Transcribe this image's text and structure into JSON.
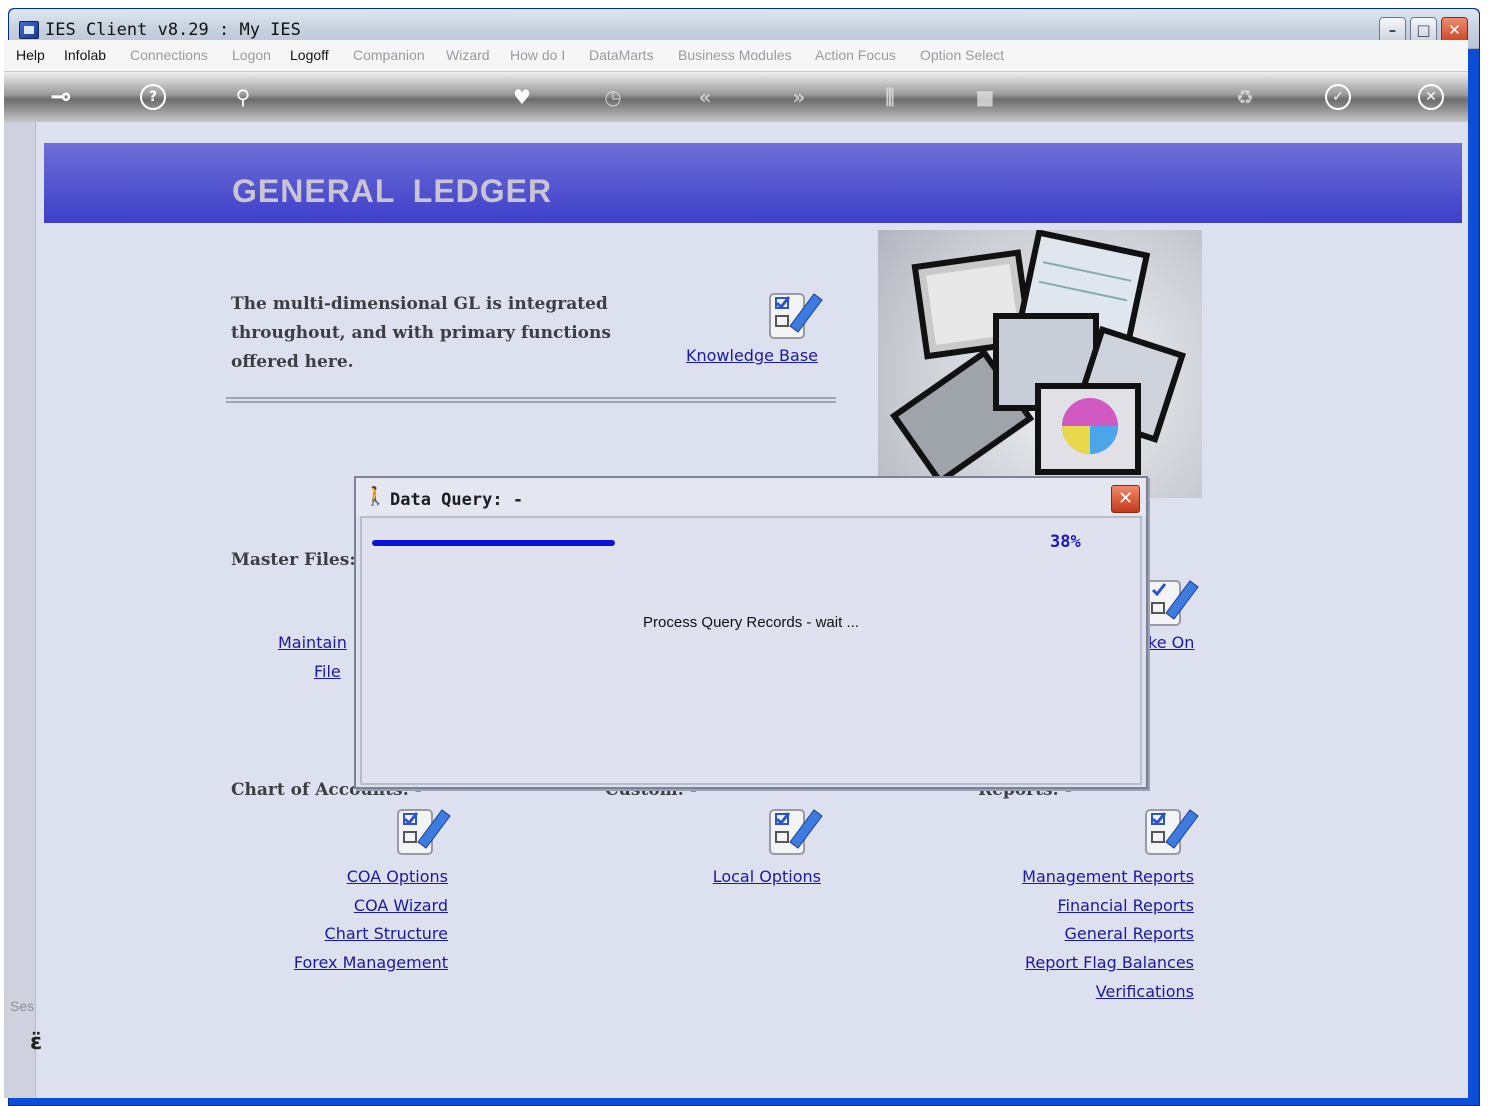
{
  "window": {
    "title": "IES Client v8.29 : My IES",
    "minimize": "–",
    "maximize": "□",
    "close": "✕"
  },
  "menu": [
    {
      "label": "Help",
      "enabled": true
    },
    {
      "label": "Infolab",
      "enabled": true
    },
    {
      "label": "Connections",
      "enabled": false
    },
    {
      "label": "Logon",
      "enabled": false
    },
    {
      "label": "Logoff",
      "enabled": true
    },
    {
      "label": "Companion",
      "enabled": false
    },
    {
      "label": "Wizard",
      "enabled": false
    },
    {
      "label": "How do I",
      "enabled": false
    },
    {
      "label": "DataMarts",
      "enabled": false
    },
    {
      "label": "Business Modules",
      "enabled": false
    },
    {
      "label": "Action Focus",
      "enabled": false
    },
    {
      "label": "Option Select",
      "enabled": false
    }
  ],
  "toolbar": {
    "icons": [
      "key-icon",
      "help-icon",
      "search-icon",
      "heart-icon",
      "clock-icon",
      "back-icon",
      "forward-icon",
      "tools-icon",
      "stop-icon",
      "recycle-icon",
      "check-icon",
      "close-icon"
    ],
    "glyphs": {
      "key": "⊸",
      "help": "?",
      "search": "⚲",
      "heart": "♥",
      "clock": "◷",
      "back": "«",
      "forward": "»",
      "tools": "⫼",
      "stop": "■",
      "recycle": "♻",
      "check": "✓",
      "close": "✕"
    }
  },
  "session": {
    "label": "Ses",
    "icon_glyph": "ɛ̈"
  },
  "page": {
    "banner_title": "GENERAL LEDGER",
    "intro": "The multi-dimensional GL is integrated throughout, and with primary functions offered here.",
    "knowledge_base": "Knowledge Base"
  },
  "sections": {
    "master_files": "Master Files:",
    "master_links": [
      "Maintain",
      "File",
      "ke On"
    ],
    "chart_of_accounts": "Chart of Accounts: -",
    "coa_links": [
      "COA Options",
      "COA Wizard",
      "Chart Structure",
      "Forex Management"
    ],
    "custom": "Custom: -",
    "custom_links": [
      "Local Options"
    ],
    "reports": "Reports: -",
    "report_links": [
      "Management Reports",
      "Financial Reports",
      "General Reports",
      "Report Flag Balances",
      "Verifications"
    ]
  },
  "dialog": {
    "title": "Data Query: -",
    "progress_fraction": 0.38,
    "progress_text": "38%",
    "message": "Process Query Records - wait ...",
    "close": "✕",
    "icon": "walking-person-icon"
  },
  "colors": {
    "banner": "#4a4bd0",
    "link": "#1a1a9e",
    "progress": "#1010dd",
    "background": "#dde0ef"
  }
}
